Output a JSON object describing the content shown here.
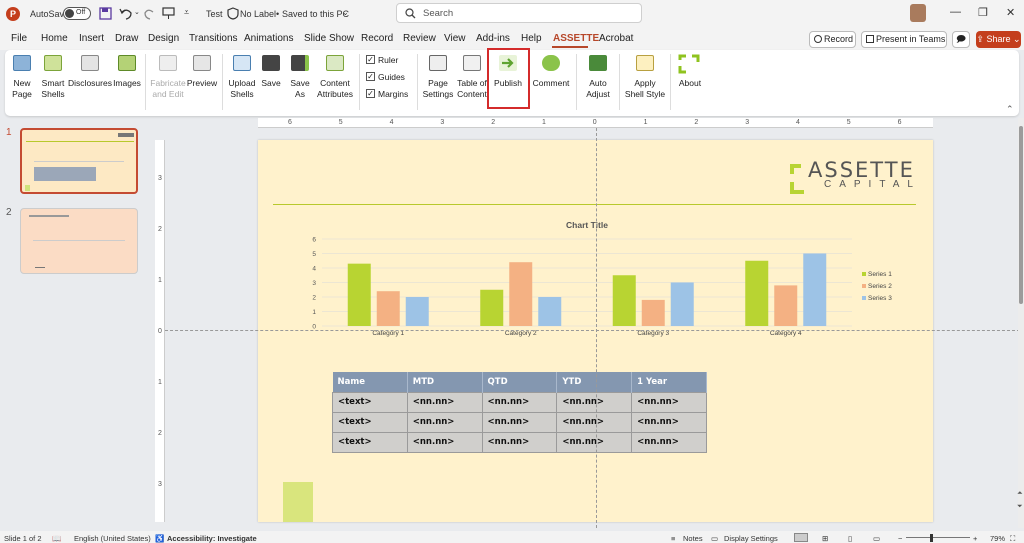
{
  "titlebar": {
    "autosave_label": "AutoSave",
    "autosave_state": "Off",
    "doc_name": "Test",
    "sensitivity": "No Label",
    "save_status": "Saved to this PC",
    "search_placeholder": "Search"
  },
  "menu": {
    "tabs": [
      "File",
      "Home",
      "Insert",
      "Draw",
      "Design",
      "Transitions",
      "Animations",
      "Slide Show",
      "Record",
      "Review",
      "View",
      "Add-ins",
      "Help",
      "ASSETTE",
      "Acrobat"
    ],
    "active_tab": "ASSETTE",
    "record_label": "Record",
    "present_label": "Present in Teams",
    "share_label": "Share"
  },
  "ribbon": {
    "new_page": "New\nPage",
    "smart_shells": "Smart\nShells",
    "disclosures": "Disclosures",
    "images": "Images",
    "fabricate": "Fabricate\nand Edit",
    "preview": "Preview",
    "upload_shells": "Upload\nShells",
    "save": "Save",
    "save_as": "Save\nAs",
    "content_attributes": "Content\nAttributes",
    "ruler": "Ruler",
    "guides": "Guides",
    "margins": "Margins",
    "page_settings": "Page\nSettings",
    "toc": "Table of\nContent",
    "publish": "Publish",
    "comment": "Comment",
    "auto_adjust": "Auto\nAdjust",
    "apply_shell_style": "Apply\nShell Style",
    "about": "About"
  },
  "slides_pane": {
    "numbers": [
      "1",
      "2"
    ]
  },
  "ruler": {
    "h_ticks": [
      "6",
      "5",
      "4",
      "3",
      "2",
      "1",
      "0",
      "1",
      "2",
      "3",
      "4",
      "5",
      "6"
    ],
    "v_ticks": [
      "3",
      "2",
      "1",
      "0",
      "1",
      "2",
      "3"
    ]
  },
  "slide": {
    "logo_main": "ASSETTE",
    "logo_sub": "CAPITAL",
    "table": {
      "headers": [
        "Name",
        "MTD",
        "QTD",
        "YTD",
        "1 Year"
      ],
      "rows": [
        [
          "<text>",
          "<nn.nn>",
          "<nn.nn>",
          "<nn.nn>",
          "<nn.nn>"
        ],
        [
          "<text>",
          "<nn.nn>",
          "<nn.nn>",
          "<nn.nn>",
          "<nn.nn>"
        ],
        [
          "<text>",
          "<nn.nn>",
          "<nn.nn>",
          "<nn.nn>",
          "<nn.nn>"
        ]
      ]
    }
  },
  "chart_data": {
    "type": "bar",
    "title": "Chart Title",
    "categories": [
      "Category 1",
      "Category 2",
      "Category 3",
      "Category 4"
    ],
    "series": [
      {
        "name": "Series 1",
        "values": [
          4.3,
          2.5,
          3.5,
          4.5
        ],
        "color": "#b8d432"
      },
      {
        "name": "Series 2",
        "values": [
          2.4,
          4.4,
          1.8,
          2.8
        ],
        "color": "#f4b183"
      },
      {
        "name": "Series 3",
        "values": [
          2.0,
          2.0,
          3.0,
          5.0
        ],
        "color": "#9dc3e6"
      }
    ],
    "ylim": [
      0,
      6
    ],
    "y_ticks": [
      0,
      1,
      2,
      3,
      4,
      5,
      6
    ],
    "grid": true,
    "legend": "right"
  },
  "statusbar": {
    "slide_info": "Slide 1 of 2",
    "language": "English (United States)",
    "accessibility": "Accessibility: Investigate",
    "notes": "Notes",
    "display_settings": "Display Settings",
    "zoom": "79%"
  },
  "colors": {
    "accent": "#b7472a",
    "slide_bg": "#fff2cc",
    "logo_green": "#b8d432",
    "table_header": "#8497b0"
  }
}
